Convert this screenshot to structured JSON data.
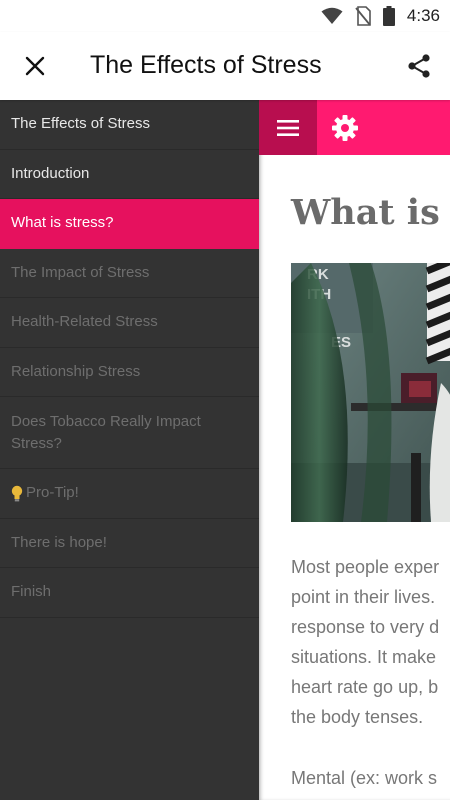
{
  "status_bar": {
    "time": "4:36",
    "icons": [
      "wifi-icon",
      "no-sim-icon",
      "battery-icon"
    ]
  },
  "app_bar": {
    "close_icon": "close-icon",
    "title": "The Effects of Stress",
    "share_icon": "share-icon"
  },
  "drawer": {
    "items": [
      {
        "label": "The Effects of Stress",
        "state": "enabled"
      },
      {
        "label": "Introduction",
        "state": "enabled"
      },
      {
        "label": "What is stress?",
        "state": "active"
      },
      {
        "label": "The Impact of Stress",
        "state": "disabled"
      },
      {
        "label": "Health-Related Stress",
        "state": "disabled"
      },
      {
        "label": "Relationship Stress",
        "state": "disabled"
      },
      {
        "label": "Does Tobacco Really Impact Stress?",
        "state": "disabled"
      },
      {
        "label": "Pro-Tip!",
        "state": "disabled",
        "icon": "lightbulb-icon"
      },
      {
        "label": "There is hope!",
        "state": "disabled"
      },
      {
        "label": "Finish",
        "state": "disabled"
      }
    ]
  },
  "content": {
    "toolbar": {
      "menu_icon": "hamburger-menu-icon",
      "settings_icon": "gear-icon"
    },
    "heading": "What is s",
    "image_text": "RK ITH ES",
    "paragraph_lines": [
      "Most people exper",
      "point in their lives.",
      "response to very d",
      "situations. It make",
      "heart rate go up, b",
      "the body tenses."
    ],
    "paragraph2": "Mental (ex: work s"
  },
  "colors": {
    "accent": "#e6115e",
    "toolbar_pink": "#ff1a70",
    "menu_button": "#b80e4f",
    "drawer_bg": "#333333"
  }
}
